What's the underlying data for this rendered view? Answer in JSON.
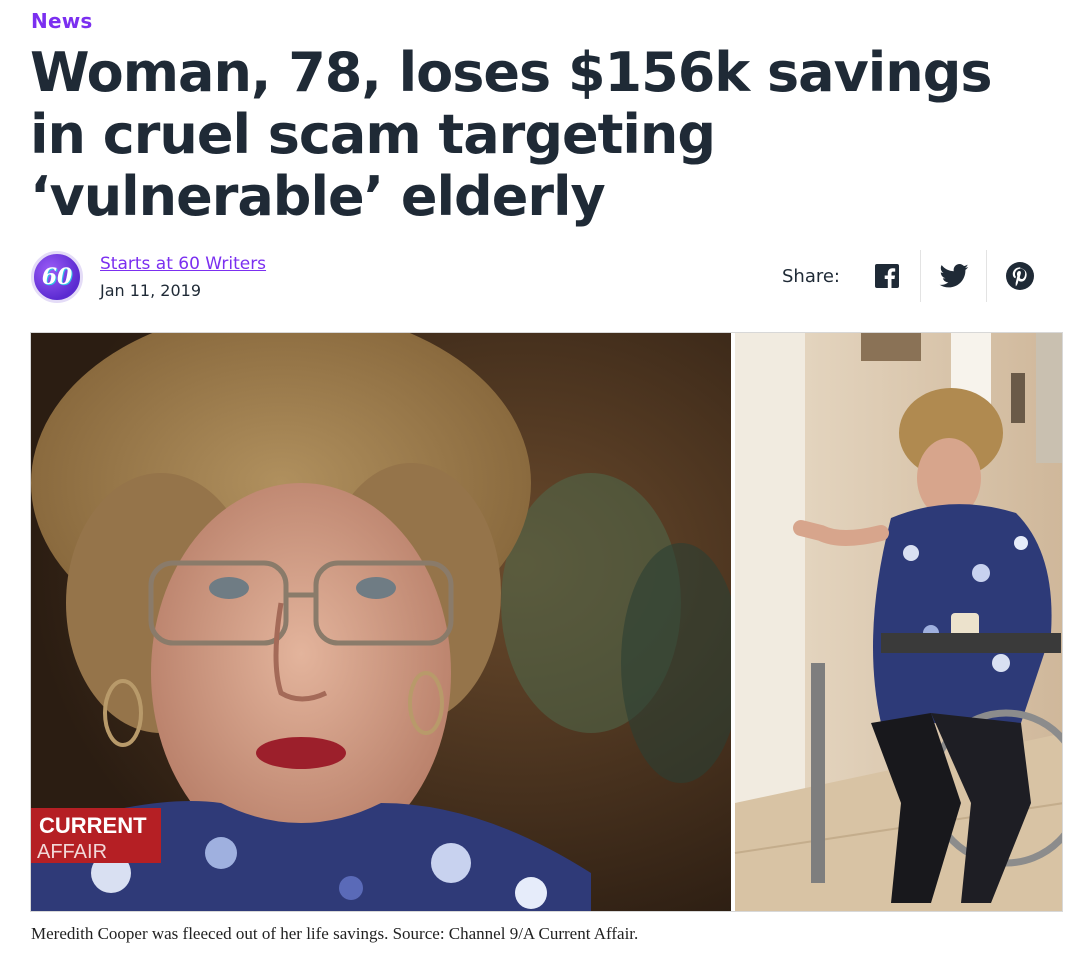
{
  "article": {
    "category": "News",
    "headline": "Woman, 78, loses $156k savings in cruel scam targeting ‘vulnerable’ elderly",
    "author": {
      "name": "Starts at 60 Writers",
      "avatar_text": "60",
      "date": "Jan 11, 2019"
    },
    "share": {
      "label": "Share:",
      "buttons": [
        {
          "icon": "facebook-icon",
          "color": "#1f2a36"
        },
        {
          "icon": "twitter-icon",
          "color": "#1f2a36"
        },
        {
          "icon": "pinterest-icon",
          "color": "#1f2a36"
        }
      ]
    },
    "image": {
      "watermark_line1": "CURRENT",
      "watermark_line2": "AFFAIR",
      "caption": "Meredith Cooper was fleeced out of her life savings. Source: Channel 9/A Current Affair."
    }
  },
  "colors": {
    "accent": "#7b2ff0",
    "text": "#1f2a36"
  }
}
